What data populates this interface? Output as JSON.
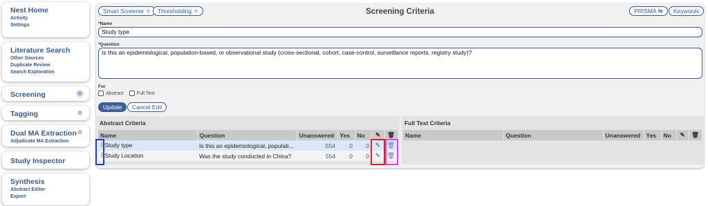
{
  "sidebar": {
    "nest_home": {
      "title": "Nest Home",
      "items": [
        "Activity",
        "Settings"
      ]
    },
    "literature_search": {
      "title": "Literature Search",
      "items": [
        "Other Sources",
        "Duplicate Review",
        "Search Exploration"
      ]
    },
    "screening": {
      "title": "Screening"
    },
    "tagging": {
      "title": "Tagging"
    },
    "dual_ma": {
      "title": "Dual MA Extraction",
      "items": [
        "Adjudicate MA Extraction"
      ]
    },
    "study_inspector": {
      "title": "Study Inspector"
    },
    "synthesis": {
      "title": "Synthesis",
      "items": [
        "Abstract Editor",
        "Export"
      ]
    }
  },
  "toolbar": {
    "smart_screener": "Smart Screener",
    "thresholding": "Thresholding",
    "title": "Screening Criteria",
    "prisma": "PRISMA",
    "keywords": "Keywords"
  },
  "form": {
    "name_label": "*Name",
    "name_value": "Study type",
    "question_label": "*Question",
    "question_value": "Is this an epidemiological, population-based, or observational study (cross-sectional, cohort, case-control, surveillance reports, registry study)?",
    "for_label": "For",
    "abstract_label": "Abstract",
    "full_text_label": "Full Text",
    "update_label": "Update",
    "cancel_label": "Cancel Edit"
  },
  "abstract_table": {
    "title": "Abstract Criteria",
    "columns": {
      "name": "Name",
      "question": "Question",
      "unanswered": "Unanswered",
      "yes": "Yes",
      "no": "No"
    },
    "rows": [
      {
        "name": "Study type",
        "question": "Is this an epidemiological, populati...",
        "unanswered": "554",
        "yes": "0",
        "no": "0"
      },
      {
        "name": "Study Location",
        "question": "Was the study conducted in China?",
        "unanswered": "554",
        "yes": "0",
        "no": "0"
      }
    ]
  },
  "fulltext_table": {
    "title": "Full Text Criteria",
    "columns": {
      "name": "Name",
      "question": "Question",
      "unanswered": "Unanswered",
      "yes": "Yes",
      "no": "No"
    }
  },
  "colors": {
    "accent": "#3a5a8c",
    "highlight_blue": "#1f3fbf",
    "highlight_red": "#e0201f",
    "highlight_magenta": "#e040e8"
  }
}
